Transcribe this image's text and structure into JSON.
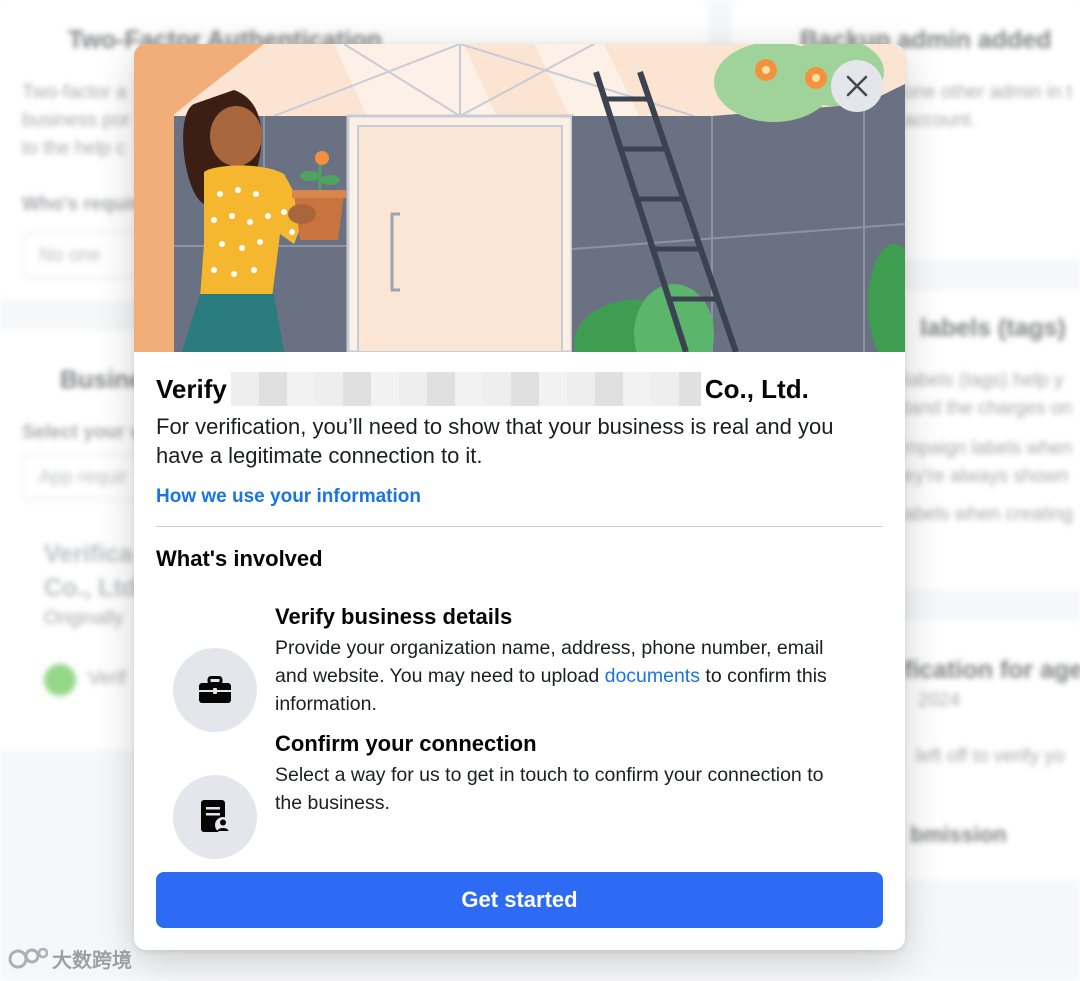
{
  "background": {
    "two_factor_title": "Two-Factor Authentication",
    "two_factor_text_1": "Two-factor a",
    "two_factor_text_2": "business por",
    "two_factor_text_3": "to the help c",
    "who_required_label": "Who's requir",
    "no_one_value": "No one",
    "backup_admin_title": "Backup admin added",
    "backup_admin_text_1": "one other admin in t",
    "backup_admin_text_2": "account.",
    "business_title": "Busine",
    "select_label": "Select your v",
    "app_required": "App requir",
    "verification_title_1": "Verifica",
    "verification_title_2": "Co., Ltd.",
    "originally_text": "Originally",
    "verified_text": "Verif",
    "labels_title": "labels (tags)",
    "labels_text_1": "labels (tags) help y",
    "labels_text_2": "tand the charges on",
    "labels_text_3": "mpaign labels when",
    "labels_text_4": "ey're always shown",
    "labels_text_5": "abels when creating",
    "agency_title": "fication for age",
    "agency_date": "2024",
    "agency_text": "left off to verify yo",
    "submission_text": "bmission"
  },
  "modal": {
    "title_prefix": "Verify",
    "title_suffix": "Co., Ltd.",
    "subtitle": "For verification, you’ll need to show that your business is real and you have a legitimate connection to it.",
    "info_link": "How we use your information",
    "section_title": "What's involved",
    "steps": [
      {
        "icon": "briefcase-icon",
        "title": "Verify business details",
        "desc_before": "Provide your organization name, address, phone number, email and website. You may need to upload ",
        "desc_link": "documents",
        "desc_after": " to confirm this information."
      },
      {
        "icon": "document-person-icon",
        "title": "Confirm your connection",
        "desc": "Select a way for us to get in touch to confirm your connection to the business."
      }
    ],
    "cta_label": "Get started",
    "close_icon": "close-icon"
  },
  "watermark": {
    "text": "大数跨境"
  },
  "colors": {
    "link": "#1b74e4",
    "primary_button": "#2d6bf5",
    "icon_circle": "#e4e6eb"
  }
}
